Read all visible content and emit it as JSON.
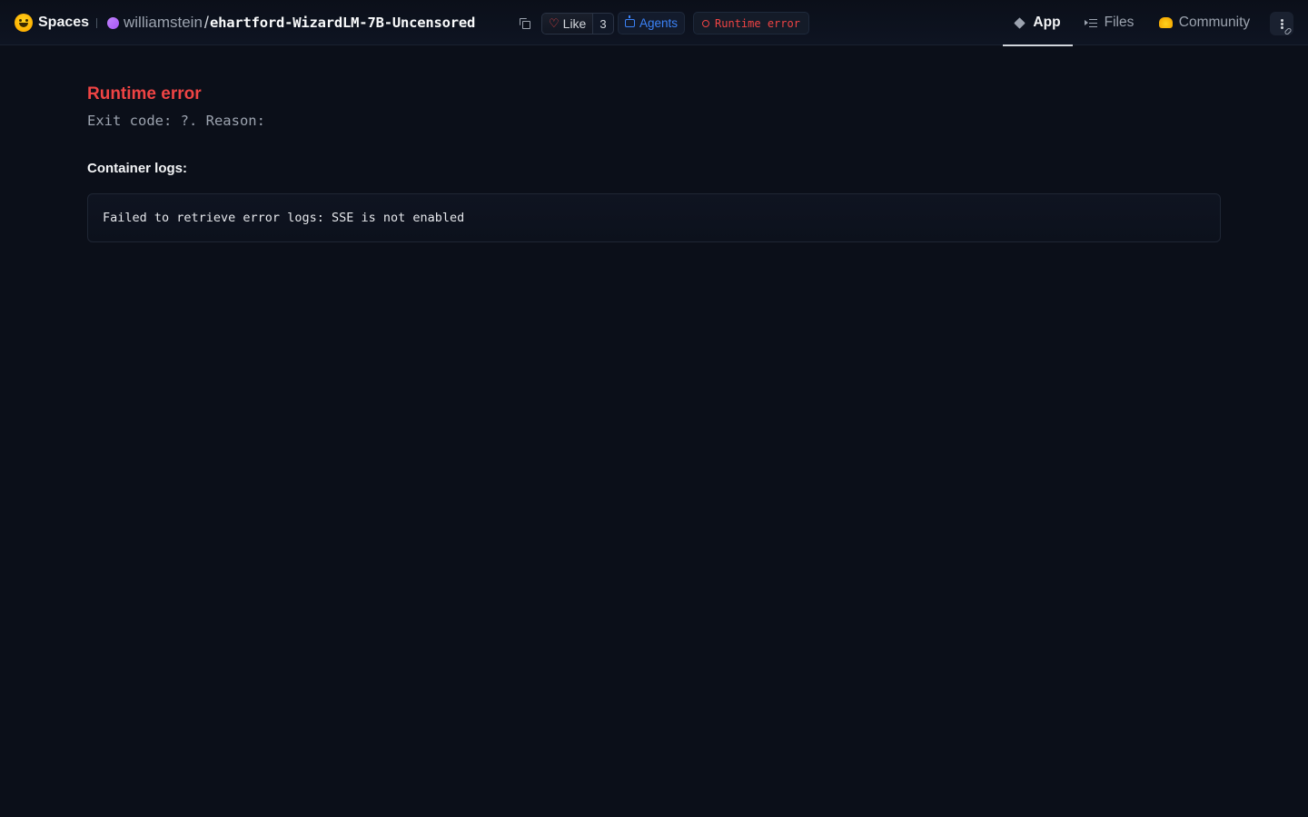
{
  "header": {
    "brand": "Spaces",
    "owner": "williamstein",
    "separator": "/",
    "repo_name": "ehartford-WizardLM-7B-Uncensored",
    "like_label": "Like",
    "like_count": "3",
    "agents_label": "Agents",
    "status_label": "Runtime error",
    "tabs": [
      {
        "label": "App",
        "icon": "cube-icon",
        "active": true
      },
      {
        "label": "Files",
        "icon": "files-icon",
        "active": false
      },
      {
        "label": "Community",
        "icon": "community-icon",
        "active": false
      }
    ]
  },
  "main": {
    "error_title": "Runtime error",
    "exit_line": "Exit code: ?. Reason:",
    "logs_heading": "Container logs:",
    "logs_text": "Failed to retrieve error logs: SSE is not enabled"
  },
  "colors": {
    "background": "#0b0f19",
    "error": "#ef4444",
    "accent_blue": "#3b82f6",
    "brand_yellow": "#ffd21e"
  }
}
